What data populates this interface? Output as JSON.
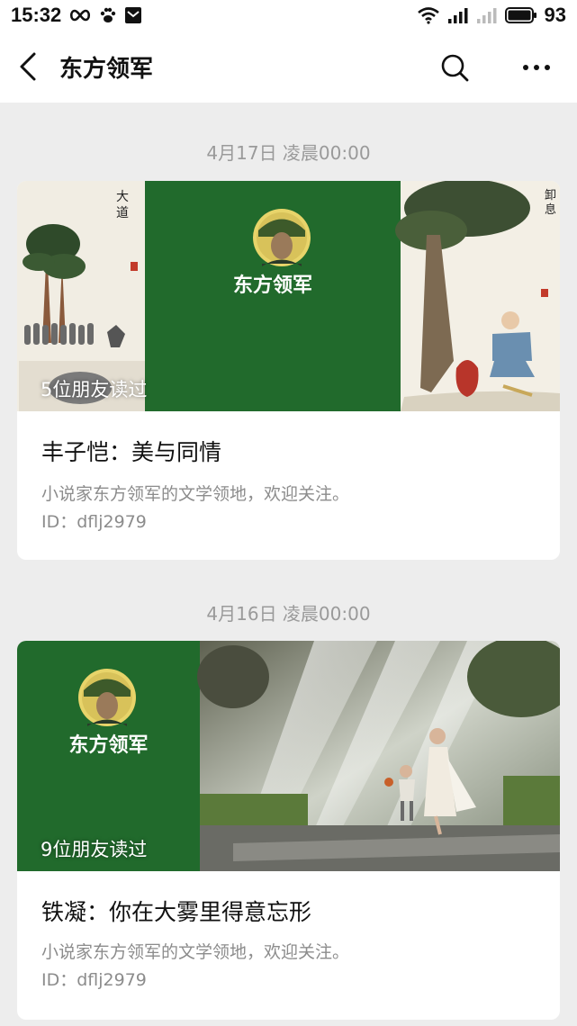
{
  "status_bar": {
    "time": "15:32",
    "battery": "93"
  },
  "nav": {
    "title": "东方领军"
  },
  "posts": [
    {
      "timestamp": "4月17日 凌晨00:00",
      "read_badge": "5位朋友读过",
      "logo_text": "东方领军",
      "title": "丰子恺：美与同情",
      "description": "小说家东方领军的文学领地，欢迎关注。",
      "id_text": "ID：dflj2979"
    },
    {
      "timestamp": "4月16日 凌晨00:00",
      "read_badge": "9位朋友读过",
      "logo_text": "东方领军",
      "title": "铁凝：你在大雾里得意忘形",
      "description": "小说家东方领军的文学领地，欢迎关注。",
      "id_text": "ID：dflj2979"
    }
  ],
  "colors": {
    "accent_green": "#216a2c",
    "background": "#ededed"
  }
}
